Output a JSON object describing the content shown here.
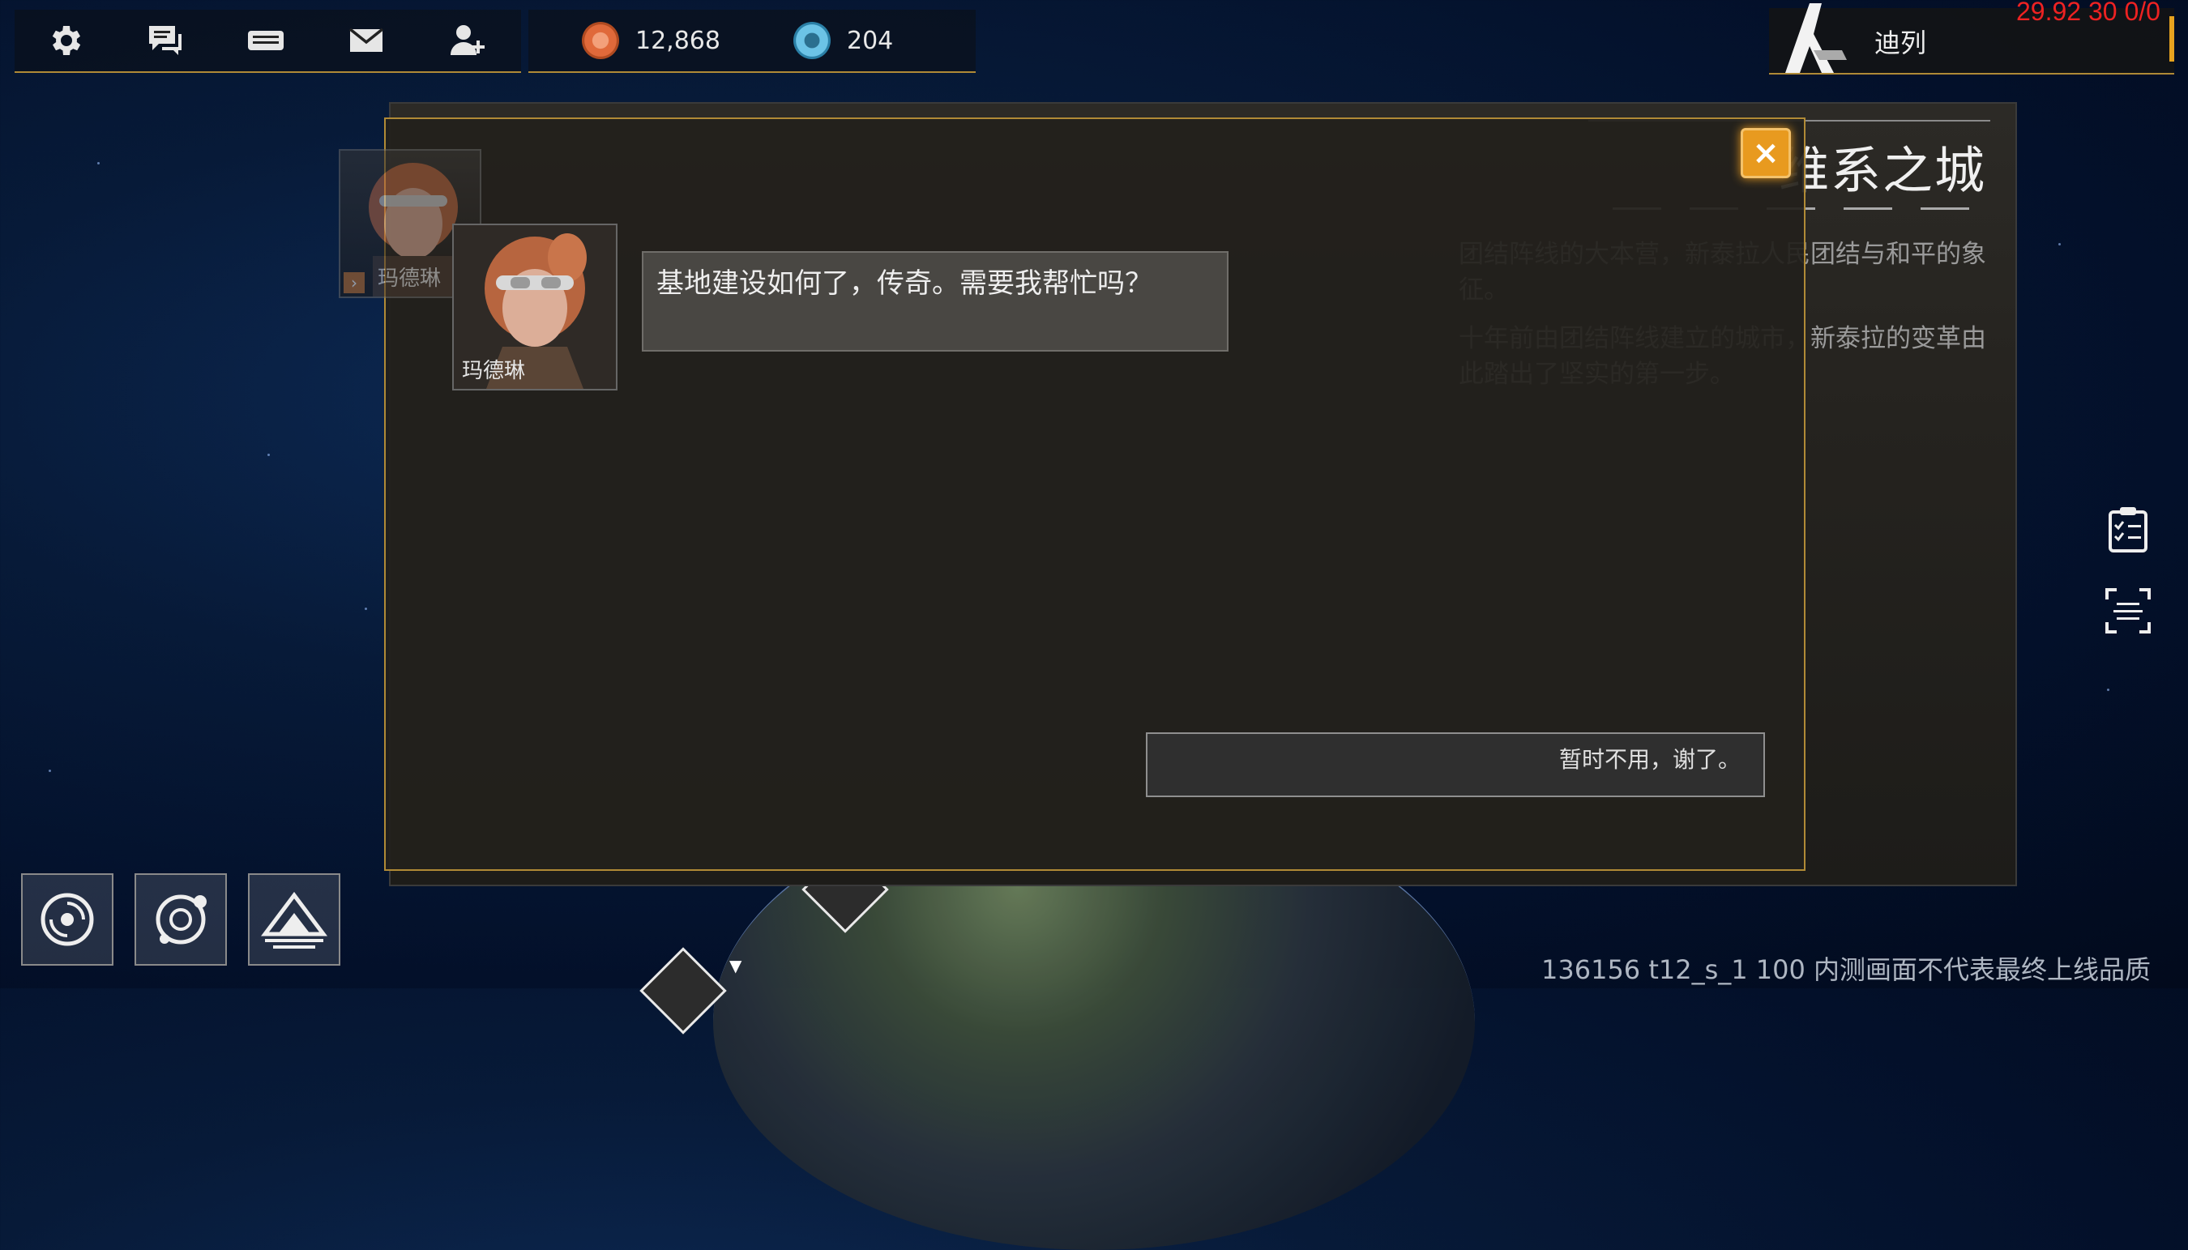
{
  "topbar": {
    "icons": [
      "gear-icon",
      "chat-icon",
      "gamepad-icon",
      "mail-icon",
      "friend-icon"
    ]
  },
  "resources": [
    {
      "icon": "orange-crystal-icon",
      "value": "12,868",
      "color": "#e0693a"
    },
    {
      "icon": "blue-token-icon",
      "value": "204",
      "color": "#6cc3e6"
    }
  ],
  "player": {
    "name": "迪列"
  },
  "debug": {
    "fps": "29.92 30 0/0"
  },
  "city": {
    "title": "维系之城",
    "desc": [
      "团结阵线的大本营，新泰拉人民团结与和平的象征。",
      "十年前由团结阵线建立的城市，新泰拉的变革由此踏出了坚实的第一步。"
    ]
  },
  "dialog": {
    "speaker": "玛德琳",
    "previous_speaker": "玛德琳",
    "line": "基地建设如何了，传奇。需要我帮忙吗？",
    "reply": "暂时不用，谢了。",
    "close": "×"
  },
  "footer": {
    "build_info": "136156 t12_s_1 100  内测画面不代表最终上线品质"
  },
  "colors": {
    "accent": "#b08a36",
    "close": "#e89a1f"
  }
}
